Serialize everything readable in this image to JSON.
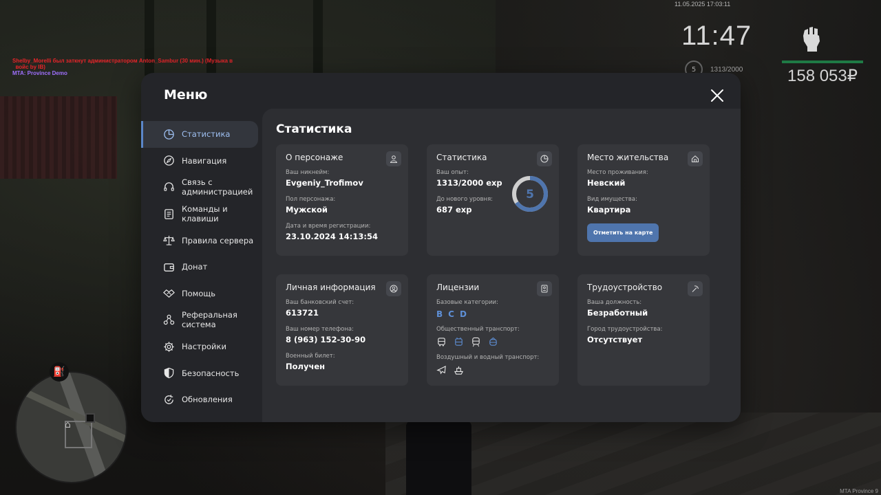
{
  "chat": {
    "line1": "Shelby_Morelli был заткнут администратором Anton_Sambur (30 мин.) (Музыка в",
    "line2": "  войс by IB)",
    "line3": "MTA: Province Demo"
  },
  "hud": {
    "datetime": "11.05.2025 17:03:11",
    "time": "11:47",
    "level": "5",
    "exp": "1313/2000",
    "money": "158 053₽"
  },
  "watermark": "MTA Province 9",
  "menu": {
    "title": "Меню",
    "sidebar": [
      {
        "label": "Статистика",
        "icon": "pie-chart-icon",
        "active": true
      },
      {
        "label": "Навигация",
        "icon": "compass-icon"
      },
      {
        "label": "Связь с администрацией",
        "icon": "headset-icon"
      },
      {
        "label": "Команды и клавиши",
        "icon": "document-icon"
      },
      {
        "label": "Правила сервера",
        "icon": "scales-icon"
      },
      {
        "label": "Донат",
        "icon": "wallet-icon"
      },
      {
        "label": "Помощь",
        "icon": "handshake-icon"
      },
      {
        "label": "Реферальная система",
        "icon": "network-icon"
      },
      {
        "label": "Настройки",
        "icon": "gear-icon"
      },
      {
        "label": "Безопасность",
        "icon": "shield-icon"
      },
      {
        "label": "Обновления",
        "icon": "update-icon"
      }
    ],
    "content_title": "Статистика",
    "cards": {
      "character": {
        "title": "О персонаже",
        "nickname_label": "Ваш никнейм:",
        "nickname": "Evgeniy_Trofimov",
        "gender_label": "Пол персонажа:",
        "gender": "Мужской",
        "reg_label": "Дата и время регистрации:",
        "reg": "23.10.2024 14:13:54"
      },
      "stats": {
        "title": "Статистика",
        "exp_label": "Ваш опыт:",
        "exp": "1313/2000 exp",
        "next_label": "До нового уровня:",
        "next": "687 exp",
        "level": "5",
        "progress": 0.6565
      },
      "residence": {
        "title": "Место жительства",
        "place_label": "Место проживания:",
        "place": "Невский",
        "type_label": "Вид имущества:",
        "type": "Квартира",
        "button": "Отметить на карте"
      },
      "personal": {
        "title": "Личная информация",
        "bank_label": "Ваш банковский счет:",
        "bank": "613721",
        "phone_label": "Ваш номер телефона:",
        "phone": "8 (963) 152-30-90",
        "military_label": "Военный билет:",
        "military": "Получен"
      },
      "licenses": {
        "title": "Лицензии",
        "base_label": "Базовые категории:",
        "categories": [
          "B",
          "C",
          "D"
        ],
        "public_label": "Общественный транспорт:",
        "air_label": "Воздушный и водный транспорт:"
      },
      "employment": {
        "title": "Трудоустройство",
        "position_label": "Ваша должность:",
        "position": "Безработный",
        "city_label": "Город трудоустройства:",
        "city": "Отсутствует"
      }
    }
  },
  "colors": {
    "accent": "#5b86c9",
    "button": "#4f75ad",
    "card": "#36373b",
    "panel": "#2d2e32",
    "money_bar": "#1f7a45"
  }
}
